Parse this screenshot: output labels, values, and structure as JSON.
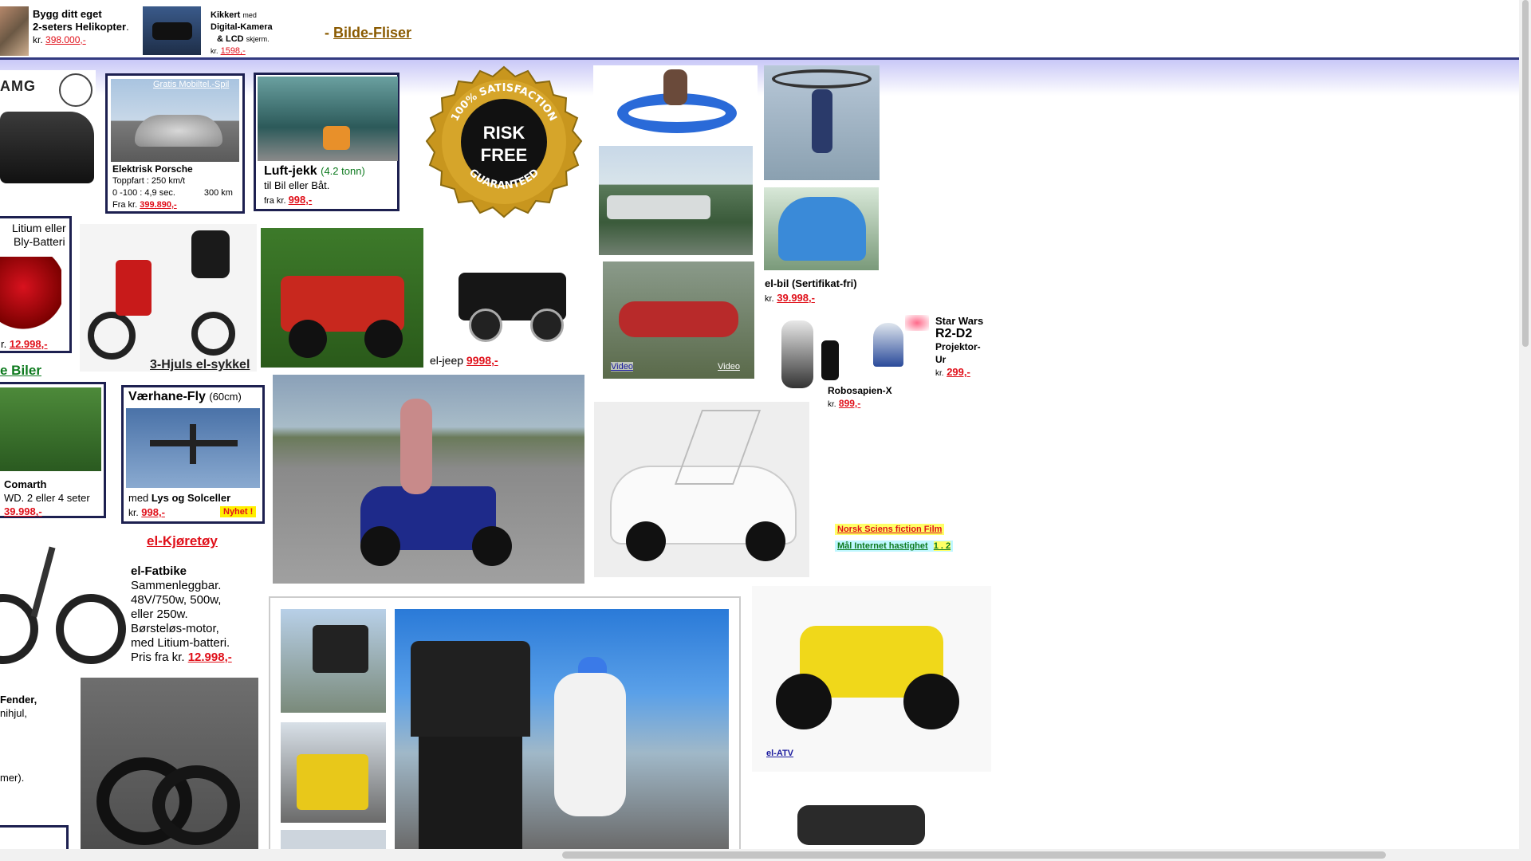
{
  "topbar": {
    "heli_title": "Bygg ditt eget",
    "heli_sub": "2-seters Helikopter",
    "heli_kr": "kr.",
    "heli_price": "398.000,-",
    "kikkert_title": "Kikkert",
    "kikkert_med": "med",
    "kikkert_line2": "Digital-Kamera",
    "kikkert_amp": "& LCD",
    "kikkert_skjerm": "skjerm.",
    "kikkert_kr": "kr.",
    "kikkert_price": "1598,-",
    "bilde_dash": "-",
    "bilde_link": "Bilde-Fliser"
  },
  "col1": {
    "amg_text": "AMG",
    "lit_line1": "Litium eller",
    "lit_line2": "Bly-Batteri",
    "lit_kr": "r.",
    "lit_price": "12.998,-",
    "biler_link": "e Biler",
    "comarth_title": "Comarth",
    "comarth_sub": "WD. 2 eller 4 seter",
    "comarth_price": "39.998,-",
    "fender_title": "Fender,",
    "fender_line": "nihjul,",
    "fender_line3": "mer)."
  },
  "porsche": {
    "ribbon": "Gratis Mobiltel.-Spil",
    "title": "Elektrisk Porsche",
    "line1": "Toppfart : 250 km/t",
    "line2": "0 -100 : 4,9 sec.",
    "line2b": "300 km",
    "line3": "Fra kr.",
    "price": "399.890,-"
  },
  "jekk": {
    "title": "Luft-jekk",
    "tonn": "(4.2 tonn)",
    "line1": "til Bil eller Båt.",
    "fra": "fra kr.",
    "price": "998,-"
  },
  "badge": {
    "ring_top": "100% SATISFACTION",
    "ring_bottom": "GUARANTEED",
    "line1": "RISK",
    "line2": "FREE"
  },
  "trike": {
    "label": "3-Hjuls el-sykkel"
  },
  "jeep": {
    "label": "el-jeep",
    "price": "9998,-"
  },
  "fly": {
    "title": "Værhane-Fly",
    "size": "(60cm)",
    "med": "med",
    "lys": "Lys og Solceller",
    "kr": "kr.",
    "price": "998,-",
    "nyhet": "Nyhet !"
  },
  "kjoretoy": {
    "label": "el-Kjøretøy"
  },
  "fatbike": {
    "title": "el-Fatbike",
    "lines": [
      "Sammenleggbar.",
      "48V/750w, 500w,",
      "eller 250w.",
      "Børsteløs-motor,",
      "med Litium-batteri."
    ],
    "pris": "Pris fra kr.",
    "price": "12.998,-"
  },
  "videos": {
    "v1": "Video",
    "v2": "Video"
  },
  "elbil": {
    "title": "el-bil (Sertifikat-fri)",
    "kr": "kr.",
    "price": "39.998,-"
  },
  "robo": {
    "name": "Robosapien-X",
    "kr": "kr.",
    "price": "899,-",
    "sw1": "Star Wars",
    "sw2": "R2-D2",
    "sw3": "Projektor-",
    "sw4": "Ur",
    "sw_kr": "kr.",
    "sw_price": "299,-"
  },
  "links": {
    "scifi": "Norsk Sciens fiction Film",
    "speed": "Mål Internet hastighet",
    "speed_nums": "1 . 2"
  },
  "atv": {
    "label": "el-ATV"
  }
}
